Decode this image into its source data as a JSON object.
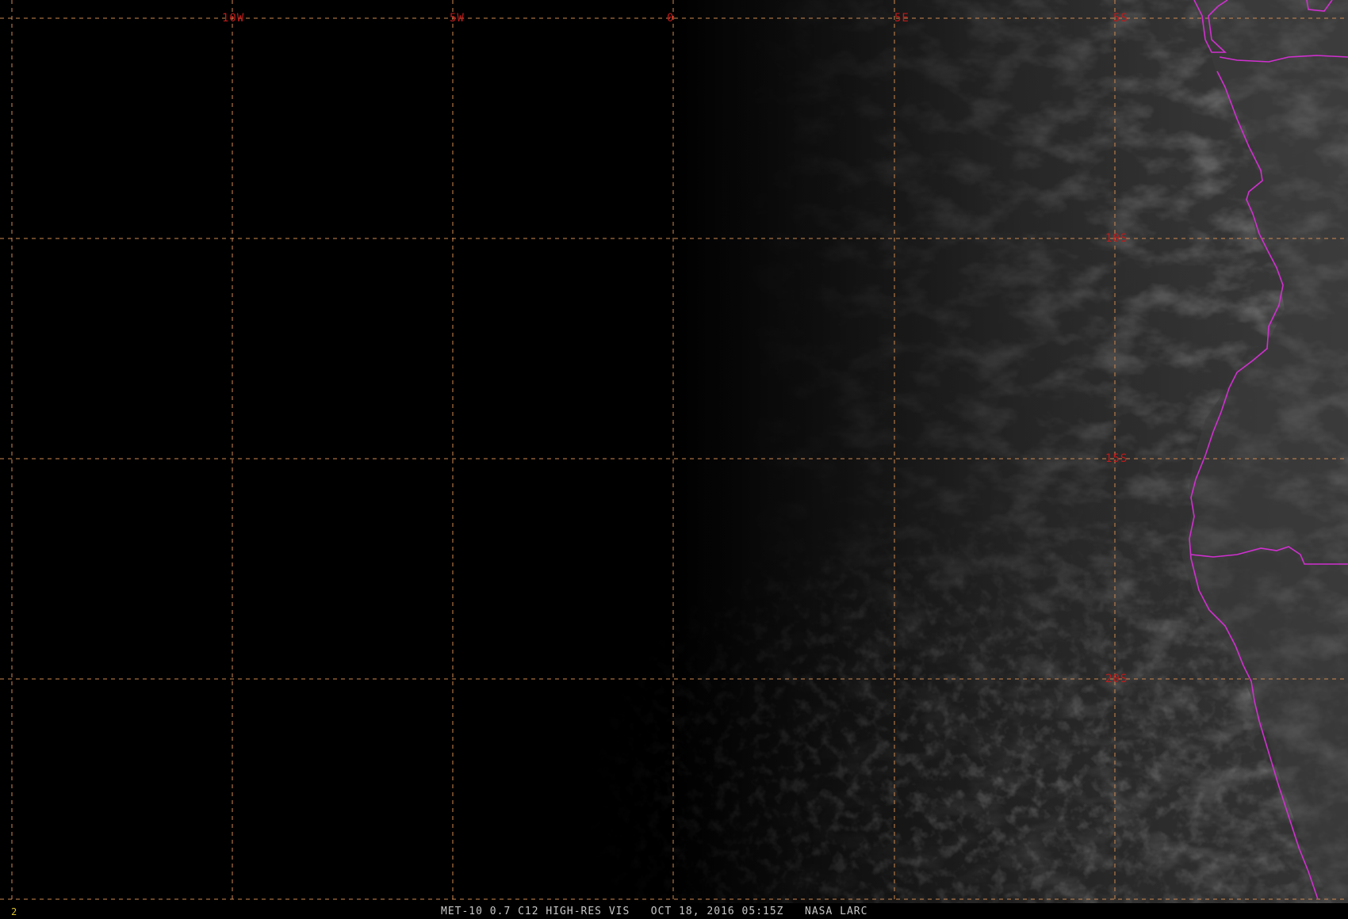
{
  "map": {
    "longitude_labels": [
      "10W",
      "5W",
      "0",
      "5E"
    ],
    "latitude_labels": [
      "5S",
      "10S",
      "15S",
      "20S"
    ],
    "colors": {
      "background": "#000000",
      "grid_line": "#d08a50",
      "grid_label": "#c21a1a",
      "boundary": "#d030d0",
      "cloud": "#ffffff"
    },
    "icons": {
      "country-boundary": "magenta-polyline"
    }
  },
  "footer": {
    "frame_number": "2",
    "caption": "MET-10 0.7 C12 HIGH-RES VIS   OCT 18, 2016 05:15Z   NASA LARC"
  }
}
